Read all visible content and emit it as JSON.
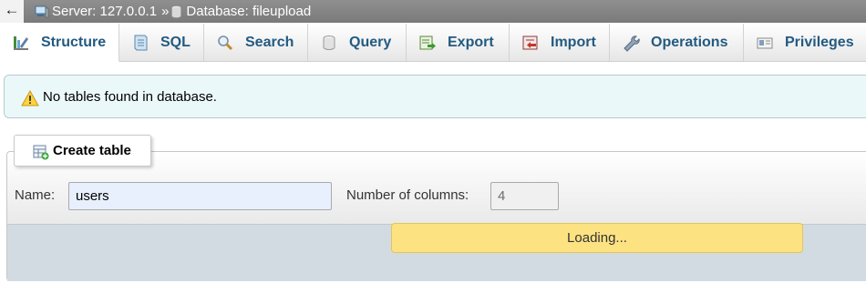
{
  "topbar": {
    "back_glyph": "←",
    "server_label": "Server: 127.0.0.1",
    "separator": "»",
    "database_label": "Database: fileupload"
  },
  "tabs": [
    {
      "label": "Structure",
      "icon": "structure-icon",
      "active": true
    },
    {
      "label": "SQL",
      "icon": "sql-icon",
      "active": false
    },
    {
      "label": "Search",
      "icon": "search-icon",
      "active": false
    },
    {
      "label": "Query",
      "icon": "query-icon",
      "active": false
    },
    {
      "label": "Export",
      "icon": "export-icon",
      "active": false
    },
    {
      "label": "Import",
      "icon": "import-icon",
      "active": false
    },
    {
      "label": "Operations",
      "icon": "wrench-icon",
      "active": false
    },
    {
      "label": "Privileges",
      "icon": "privileges-icon",
      "active": false
    }
  ],
  "notice": {
    "message": "No tables found in database.",
    "icon": "warning-icon"
  },
  "create_table": {
    "legend": "Create table",
    "name_label": "Name:",
    "name_value": "users",
    "columns_label": "Number of columns:",
    "columns_value": "4"
  },
  "loading": {
    "text": "Loading..."
  },
  "colors": {
    "tab_text": "#235a81",
    "topbar_bg": "#8a8a8a",
    "notice_bg": "#ebf8fa",
    "loading_bg": "#fde282"
  }
}
